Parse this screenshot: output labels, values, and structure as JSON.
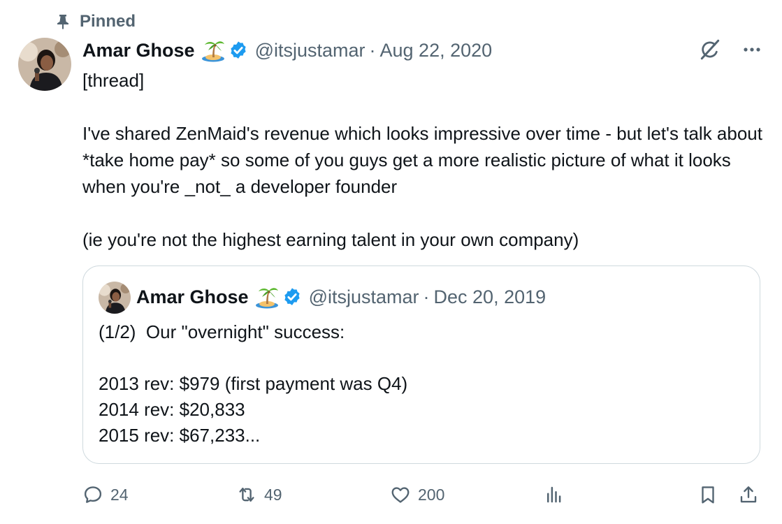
{
  "pinned": {
    "label": "Pinned",
    "icon": "pin-icon"
  },
  "tweet": {
    "author": {
      "name": "Amar Ghose",
      "emoji": "desert-island-emoji",
      "verified_icon": "verified-badge-icon",
      "handle": "@itsjustamar"
    },
    "separator": "·",
    "date": "Aug 22, 2020",
    "text": "[thread]\n\nI've shared ZenMaid's revenue which looks impressive over time - but let's talk about *take home pay* so some of you guys get a more realistic picture of what it looks when you're _not_ a developer founder\n\n(ie you're not the highest earning talent in your own company)"
  },
  "quoted_tweet": {
    "author": {
      "name": "Amar Ghose",
      "emoji": "desert-island-emoji",
      "verified_icon": "verified-badge-icon",
      "handle": "@itsjustamar"
    },
    "separator": "·",
    "date": "Dec 20, 2019",
    "text": "(1/2)  Our \"overnight\" success:\n\n2013 rev: $979 (first payment was Q4)\n2014 rev: $20,833\n2015 rev: $67,233..."
  },
  "top_actions": {
    "grok_icon": "grok-icon",
    "more_icon": "more-icon"
  },
  "actions": {
    "reply": {
      "icon": "reply-icon",
      "count": "24"
    },
    "retweet": {
      "icon": "retweet-icon",
      "count": "49"
    },
    "like": {
      "icon": "heart-icon",
      "count": "200"
    },
    "views": {
      "icon": "analytics-icon"
    },
    "bookmark": {
      "icon": "bookmark-icon"
    },
    "share": {
      "icon": "share-icon"
    }
  },
  "colors": {
    "text": "#0f1419",
    "muted": "#536471",
    "verified": "#1d9bf0",
    "border": "#cfd9de"
  }
}
